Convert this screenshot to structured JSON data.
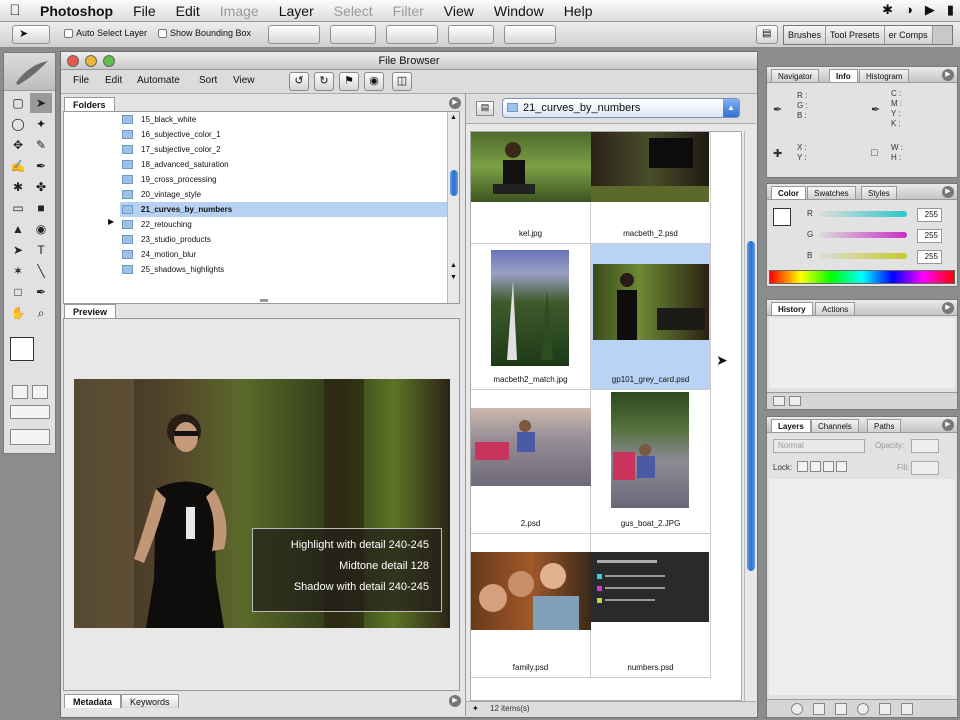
{
  "menubar": {
    "items": [
      {
        "label": "Photoshop",
        "enabled": true
      },
      {
        "label": "File",
        "enabled": true
      },
      {
        "label": "Edit",
        "enabled": true
      },
      {
        "label": "Image",
        "enabled": false
      },
      {
        "label": "Layer",
        "enabled": true
      },
      {
        "label": "Select",
        "enabled": false
      },
      {
        "label": "Filter",
        "enabled": false
      },
      {
        "label": "View",
        "enabled": true
      },
      {
        "label": "Window",
        "enabled": true
      },
      {
        "label": "Help",
        "enabled": true
      }
    ]
  },
  "options_bar": {
    "auto_select_layer": "Auto Select Layer",
    "show_bounding_box": "Show Bounding Box",
    "palette_well": [
      "Brushes",
      "Tool Presets",
      "er Comps"
    ]
  },
  "file_browser": {
    "title": "File Browser",
    "menu": [
      "File",
      "Edit",
      "Automate",
      "Sort",
      "View"
    ],
    "folders_tab": "Folders",
    "folders": [
      "15_black_white",
      "16_subjective_color_1",
      "17_subjective_color_2",
      "18_advanced_saturation",
      "19_cross_processing",
      "20_vintage_style",
      "21_curves_by_numbers",
      "22_retouching",
      "23_studio_products",
      "24_motion_blur",
      "25_shadows_highlights"
    ],
    "selected_folder_index": 6,
    "preview_tab": "Preview",
    "preview_overlay": [
      "Highlight with detail 240-245",
      "Midtone detail 128",
      "Shadow with detail 240-245"
    ],
    "bottom_tabs": [
      "Metadata",
      "Keywords"
    ],
    "path": "21_curves_by_numbers",
    "files": [
      {
        "name": "kel.jpg"
      },
      {
        "name": "macbeth_2.psd"
      },
      {
        "name": "macbeth2_match.jpg"
      },
      {
        "name": "gp101_grey_card.psd",
        "selected": true
      },
      {
        "name": "2.psd"
      },
      {
        "name": "gus_boat_2.JPG"
      },
      {
        "name": "family.psd"
      },
      {
        "name": "numbers.psd"
      }
    ],
    "status": "12 items(s)"
  },
  "palettes": {
    "info": {
      "tabs": [
        "Navigator",
        "Info",
        "Histogram"
      ],
      "rgb_labels": [
        "R :",
        "G :",
        "B :"
      ],
      "cmyk_labels": [
        "C :",
        "M :",
        "Y :",
        "K :"
      ],
      "xy_labels": [
        "X :",
        "Y :"
      ],
      "wh_labels": [
        "W :",
        "H :"
      ]
    },
    "color": {
      "tabs": [
        "Color",
        "Swatches",
        "Styles"
      ],
      "channels": [
        {
          "label": "R",
          "value": "255",
          "color": "#2cc7c7"
        },
        {
          "label": "G",
          "value": "255",
          "color": "#c72cc7"
        },
        {
          "label": "B",
          "value": "255",
          "color": "#c7c72c"
        }
      ]
    },
    "history": {
      "tabs": [
        "History",
        "Actions"
      ]
    },
    "layers": {
      "tabs": [
        "Layers",
        "Channels",
        "Paths"
      ],
      "blend_mode": "Normal",
      "opacity_label": "Opacity:",
      "lock_label": "Lock:",
      "fill_label": "Fill:"
    }
  }
}
